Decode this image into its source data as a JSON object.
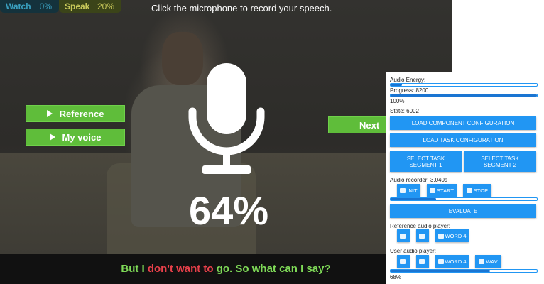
{
  "stage": {
    "tabs": [
      {
        "label": "Watch",
        "percent": "0%"
      },
      {
        "label": "Speak",
        "percent": "20%"
      }
    ],
    "instruction": "Click the microphone to record your speech.",
    "reference_button": "Reference",
    "my_voice_button": "My voice",
    "next_button": "Next",
    "percent": "64%",
    "subtitle": {
      "part1": "But I ",
      "part2": "don't want to",
      "part3": " go. So what can I say?"
    }
  },
  "panel": {
    "audio_energy_label": "Audio Energy:",
    "audio_energy_level": 0.08,
    "progress_label": "Progress: 8200",
    "progress_level": 1.0,
    "progress_percent": "100%",
    "state_label": "State: 6002",
    "load_component_button": "LOAD COMPONENT CONFIGURATION",
    "load_task_button": "LOAD TASK CONFIGURATION",
    "segment1_button": "SELECT TASK SEGMENT 1",
    "segment2_button": "SELECT TASK SEGMENT 2",
    "recorder_label": "Audio recorder: 3.040s",
    "init_button": "INIT",
    "start_button": "START",
    "stop_button": "STOP",
    "recorder_level": 0.31,
    "evaluate_button": "EVALUATE",
    "reference_player_label": "Reference audio player:",
    "word4_ref_button": "WORD 4",
    "user_player_label": "User audio player:",
    "word4_user_button": "WORD 4",
    "wav_button": "WAV",
    "user_level": 0.68,
    "user_percent": "68%"
  },
  "colors": {
    "green_button": "#5fbd3a",
    "panel_blue": "#2196f3",
    "subtitle_green": "#7ed957",
    "subtitle_red": "#e8404a"
  },
  "icons": [
    "play-icon",
    "microphone-icon",
    "square-icon",
    "save-icon"
  ]
}
